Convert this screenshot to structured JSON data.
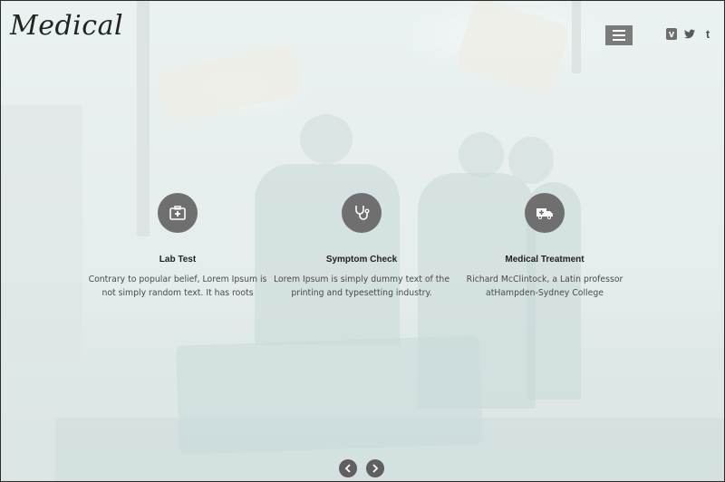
{
  "brand": {
    "logo_text": "Medical"
  },
  "header": {
    "menu_icon": "hamburger-icon"
  },
  "social": [
    {
      "name": "vimeo",
      "glyph": "v"
    },
    {
      "name": "twitter",
      "glyph": "🐦"
    },
    {
      "name": "tumblr",
      "glyph": "t"
    }
  ],
  "features": [
    {
      "icon": "first-aid-kit-icon",
      "title": "Lab Test",
      "text": "Contrary to popular belief, Lorem Ipsum is not simply random text. It has roots"
    },
    {
      "icon": "stethoscope-icon",
      "title": "Symptom Check",
      "text": "Lorem Ipsum is simply dummy text of the printing and typesetting industry."
    },
    {
      "icon": "ambulance-icon",
      "title": "Medical Treatment",
      "text": "Richard McClintock, a Latin professor atHampden-Sydney College"
    }
  ],
  "slider": {
    "prev_glyph": "‹",
    "next_glyph": "›"
  },
  "colors": {
    "icon_circle": "#6f6f6f",
    "menu_button": "#7b7b7b",
    "text": "#222222"
  }
}
